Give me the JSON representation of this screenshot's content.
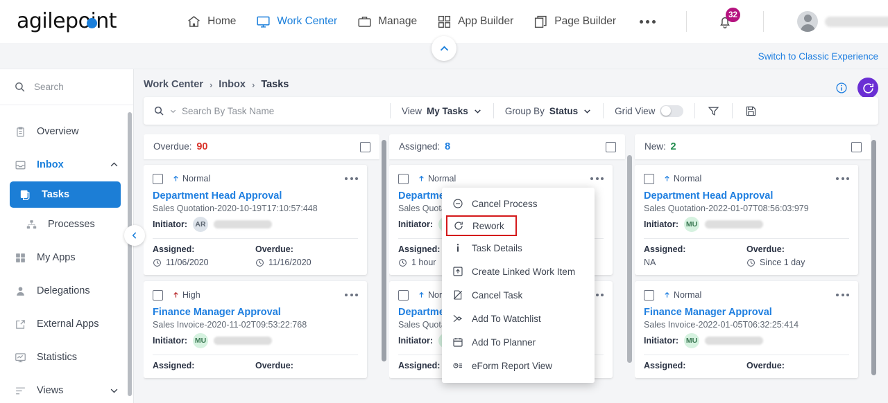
{
  "topnav": {
    "logo_text": "agilepoint",
    "items": [
      {
        "label": "Home",
        "icon": "home-icon",
        "active": false
      },
      {
        "label": "Work Center",
        "icon": "monitor-icon",
        "active": true
      },
      {
        "label": "Manage",
        "icon": "briefcase-icon",
        "active": false
      },
      {
        "label": "App Builder",
        "icon": "grid-icon",
        "active": false
      },
      {
        "label": "Page Builder",
        "icon": "pages-icon",
        "active": false
      }
    ],
    "more_label": "…",
    "notification_count": "32",
    "user_name": ""
  },
  "banner": {
    "switch_label": "Switch to Classic Experience"
  },
  "sidebar": {
    "search_placeholder": "Search",
    "items": [
      {
        "label": "Overview",
        "icon": "clipboard-icon",
        "type": "item",
        "state": "normal"
      },
      {
        "label": "Inbox",
        "icon": "inbox-icon",
        "type": "item",
        "state": "blue",
        "chevron": "chevron-up"
      },
      {
        "label": "Tasks",
        "icon": "tasks-icon",
        "type": "sub-active",
        "state": "selected"
      },
      {
        "label": "Processes",
        "icon": "hierarchy-icon",
        "type": "sub",
        "state": "normal"
      },
      {
        "label": "My Apps",
        "icon": "apps-grid-icon",
        "type": "item",
        "state": "normal"
      },
      {
        "label": "Delegations",
        "icon": "person-icon",
        "type": "item",
        "state": "normal"
      },
      {
        "label": "External Apps",
        "icon": "external-link-icon",
        "type": "item",
        "state": "normal"
      },
      {
        "label": "Statistics",
        "icon": "chart-monitor-icon",
        "type": "item",
        "state": "normal"
      },
      {
        "label": "Views",
        "icon": "lines-icon",
        "type": "item",
        "state": "normal",
        "chevron": "chevron-down"
      }
    ]
  },
  "breadcrumb": {
    "part1": "Work Center",
    "sep1": "›",
    "part2": "Inbox",
    "sep2": "›",
    "part3": "Tasks"
  },
  "toolbar": {
    "search_placeholder": "Search By Task Name",
    "view_label": "View",
    "view_value": "My Tasks",
    "group_by_label": "Group By",
    "group_by_value": "Status",
    "grid_view_label": "Grid View",
    "grid_view_on": false,
    "filter_icon": "filter-icon",
    "save_icon": "save-icon",
    "info_icon": "info-icon",
    "refresh_icon": "refresh-icon"
  },
  "columns": [
    {
      "name": "Overdue",
      "count": "90",
      "count_color": "#d9342b",
      "label_color": "#1f7fe0",
      "cards": [
        {
          "priority": "Normal",
          "priority_color": "#1f7fe0",
          "title": "Department Head Approval",
          "subtitle": "Sales Quotation-2020-10-19T17:10:57:448",
          "initiator_label": "Initiator:",
          "initiator_initials": "AR",
          "initiator_badge_style": "gray",
          "assigned_label": "Assigned:",
          "assigned_value": "11/06/2020",
          "overdue_label": "Overdue:",
          "overdue_value": "11/16/2020"
        },
        {
          "priority": "High",
          "priority_color": "#b7282a",
          "title": "Finance Manager Approval",
          "subtitle": "Sales Invoice-2020-11-02T09:53:22:768",
          "initiator_label": "Initiator:",
          "initiator_initials": "MU",
          "initiator_badge_style": "green",
          "assigned_label": "Assigned:",
          "assigned_value": "",
          "overdue_label": "Overdue:",
          "overdue_value": ""
        }
      ]
    },
    {
      "name": "Assigned",
      "count": "8",
      "count_color": "#1f7fe0",
      "label_color": "#1f7fe0",
      "cards": [
        {
          "priority": "Normal",
          "priority_color": "#1f7fe0",
          "title": "Department Head Approval",
          "subtitle": "Sales Quotation",
          "initiator_label": "Initiator:",
          "initiator_initials": "",
          "initiator_badge_style": "green",
          "assigned_label": "Assigned:",
          "assigned_value": "1 hour",
          "overdue_label": "Overdue:",
          "overdue_value": ""
        },
        {
          "priority": "Normal",
          "priority_color": "#1f7fe0",
          "title": "Department Head Approval",
          "subtitle": "Sales Quotation",
          "initiator_label": "Initiator:",
          "initiator_initials": "",
          "initiator_badge_style": "green",
          "assigned_label": "Assigned:",
          "assigned_value": "",
          "overdue_label": "Overdue:",
          "overdue_value": ""
        }
      ]
    },
    {
      "name": "New",
      "count": "2",
      "count_color": "#1f8b4c",
      "label_color": "#1f7fe0",
      "cards": [
        {
          "priority": "Normal",
          "priority_color": "#1f7fe0",
          "title": "Department Head Approval",
          "subtitle": "Sales Quotation-2022-01-07T08:56:03:979",
          "initiator_label": "Initiator:",
          "initiator_initials": "MU",
          "initiator_badge_style": "green",
          "assigned_label": "Assigned:",
          "assigned_value": "NA",
          "overdue_label": "Overdue:",
          "overdue_value": "Since 1 day"
        },
        {
          "priority": "Normal",
          "priority_color": "#1f7fe0",
          "title": "Finance Manager Approval",
          "subtitle": "Sales Invoice-2022-01-05T06:32:25:414",
          "initiator_label": "Initiator:",
          "initiator_initials": "MU",
          "initiator_badge_style": "green",
          "assigned_label": "Assigned:",
          "assigned_value": "",
          "overdue_label": "Overdue:",
          "overdue_value": ""
        }
      ]
    }
  ],
  "context_menu": {
    "items": [
      {
        "label": "Cancel Process",
        "icon": "minus-circle-icon",
        "highlight": false
      },
      {
        "label": "Rework",
        "icon": "rework-icon",
        "highlight": true
      },
      {
        "label": "Task Details",
        "icon": "info-i-icon",
        "highlight": false
      },
      {
        "label": "Create Linked Work Item",
        "icon": "linked-item-icon",
        "highlight": false
      },
      {
        "label": "Cancel Task",
        "icon": "cancel-task-icon",
        "highlight": false
      },
      {
        "label": "Add To Watchlist",
        "icon": "watchlist-icon",
        "highlight": false
      },
      {
        "label": "Add To Planner",
        "icon": "calendar-icon",
        "highlight": false
      },
      {
        "label": "eForm Report View",
        "icon": "eform-report-icon",
        "highlight": false
      }
    ],
    "highlight_color": "#d4191b"
  }
}
